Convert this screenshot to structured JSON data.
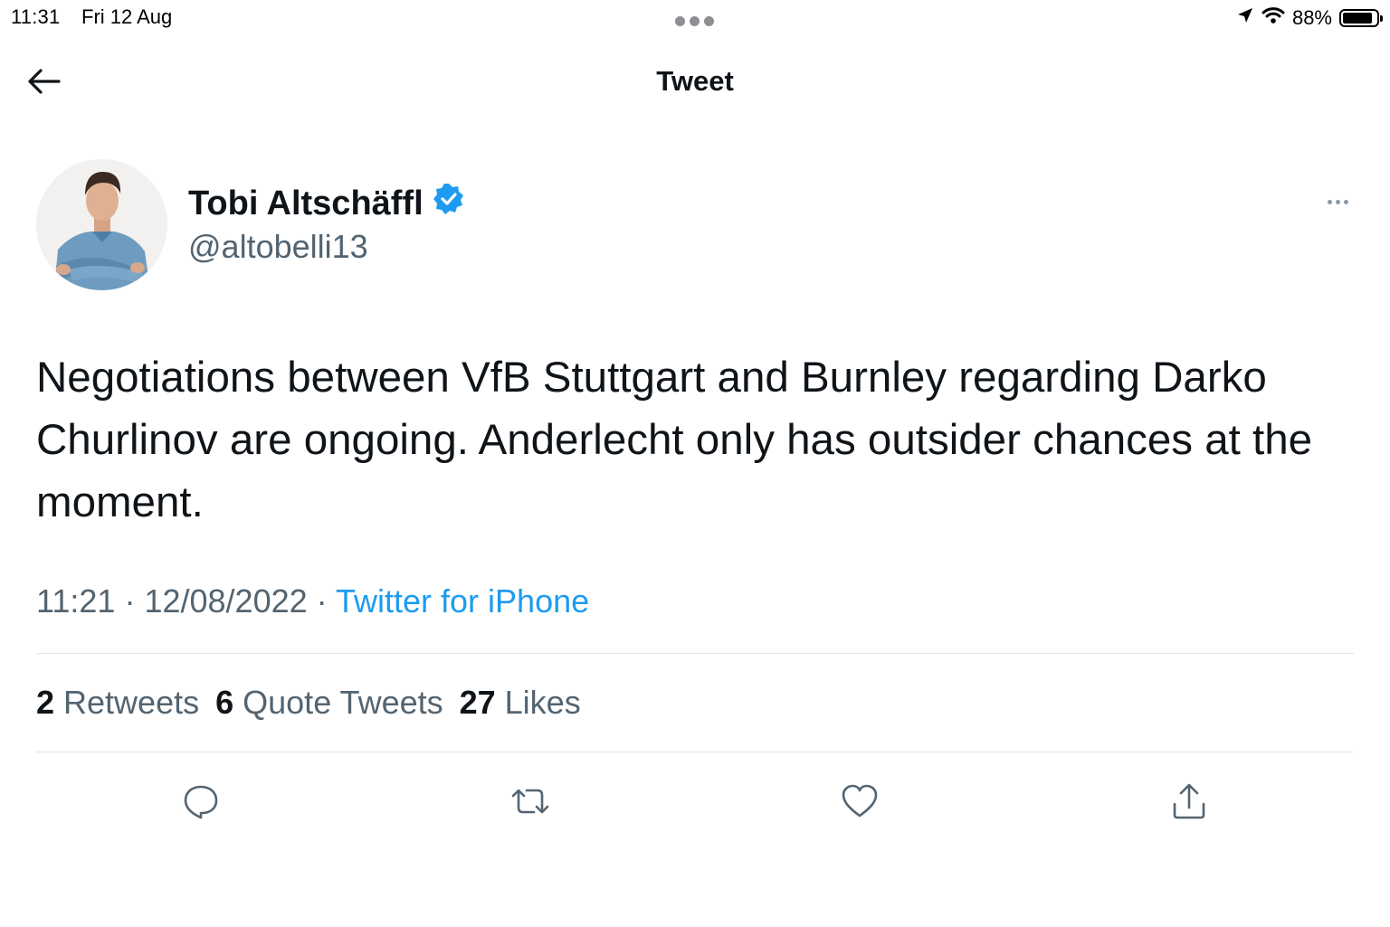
{
  "status_bar": {
    "time": "11:31",
    "date": "Fri 12 Aug",
    "battery": "88%",
    "battery_level": 0.88
  },
  "header": {
    "title": "Tweet"
  },
  "tweet": {
    "author_name": "Tobi Altschäffl",
    "author_handle": "@altobelli13",
    "text": "Negotiations between VfB Stuttgart and Burnley regarding Darko Churlinov are ongoing. Anderlecht only has outsider chances at the moment.",
    "time": "11:21",
    "date": "12/08/2022",
    "separator": "·",
    "source": "Twitter for iPhone"
  },
  "stats": {
    "retweets_count": "2",
    "retweets_label": "Retweets",
    "quotes_count": "6",
    "quotes_label": "Quote Tweets",
    "likes_count": "27",
    "likes_label": "Likes"
  },
  "colors": {
    "accent": "#1d9bf0",
    "text_primary": "#0f1419",
    "text_secondary": "#536471",
    "divider": "#e1e6ea"
  },
  "icons": [
    "back-arrow-icon",
    "verified-badge-icon",
    "more-icon",
    "reply-icon",
    "retweet-icon",
    "like-icon",
    "share-icon",
    "location-icon",
    "wifi-icon",
    "battery-icon"
  ]
}
